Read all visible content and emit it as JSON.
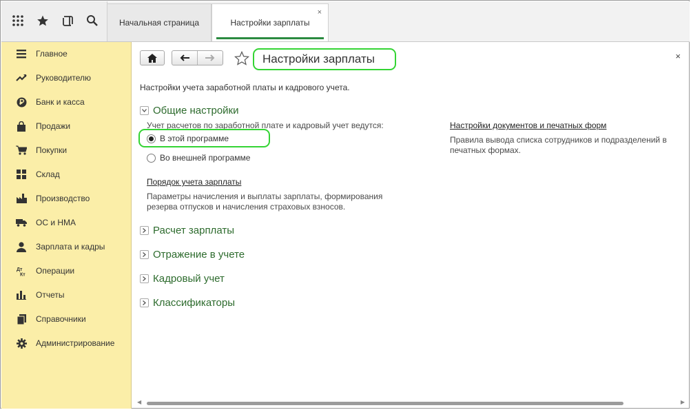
{
  "topbar": {
    "icons": [
      "apps-grid-icon",
      "favorites-star-icon",
      "history-icon",
      "search-icon"
    ],
    "tabs": [
      {
        "label": "Начальная страница",
        "active": false
      },
      {
        "label": "Настройки зарплаты",
        "active": true,
        "close": "×"
      }
    ]
  },
  "sidebar": {
    "items": [
      {
        "label": "Главное",
        "icon": "menu-lines-icon"
      },
      {
        "label": "Руководителю",
        "icon": "trend-chart-icon"
      },
      {
        "label": "Банк и касса",
        "icon": "ruble-coin-icon"
      },
      {
        "label": "Продажи",
        "icon": "shopping-bag-icon"
      },
      {
        "label": "Покупки",
        "icon": "cart-icon"
      },
      {
        "label": "Склад",
        "icon": "warehouse-grid-icon"
      },
      {
        "label": "Производство",
        "icon": "factory-icon"
      },
      {
        "label": "ОС и НМА",
        "icon": "truck-icon"
      },
      {
        "label": "Зарплата и кадры",
        "icon": "person-icon"
      },
      {
        "label": "Операции",
        "icon": "operations-dtkt-icon"
      },
      {
        "label": "Отчеты",
        "icon": "bar-chart-icon"
      },
      {
        "label": "Справочники",
        "icon": "books-icon"
      },
      {
        "label": "Администрирование",
        "icon": "gear-icon"
      }
    ]
  },
  "page": {
    "title": "Настройки зарплаты",
    "close": "×",
    "description": "Настройки учета заработной платы и кадрового учета.",
    "sections": {
      "general": {
        "title": "Общие настройки",
        "expanded": true,
        "accounting_label": "Учет расчетов по заработной плате и кадровый учет ведутся:",
        "options": [
          {
            "label": "В этой программе",
            "selected": true
          },
          {
            "label": "Во внешней программе",
            "selected": false
          }
        ],
        "link": "Порядок учета зарплаты",
        "link_desc_1": "Параметры начисления и выплаты зарплаты, формирования",
        "link_desc_2": "резерва отпусков и начисления страховых взносов.",
        "right_link": "Настройки документов и печатных форм",
        "right_desc_1": "Правила вывода списка сотрудников и подразделений в",
        "right_desc_2": "печатных формах."
      },
      "collapsed": [
        {
          "title": "Расчет зарплаты"
        },
        {
          "title": "Отражение в учете"
        },
        {
          "title": "Кадровый учет"
        },
        {
          "title": "Классификаторы"
        }
      ]
    }
  },
  "colors": {
    "accent_green": "#2a8a3f",
    "highlight_green": "#33d433",
    "sidebar_bg": "#fbeea8"
  }
}
